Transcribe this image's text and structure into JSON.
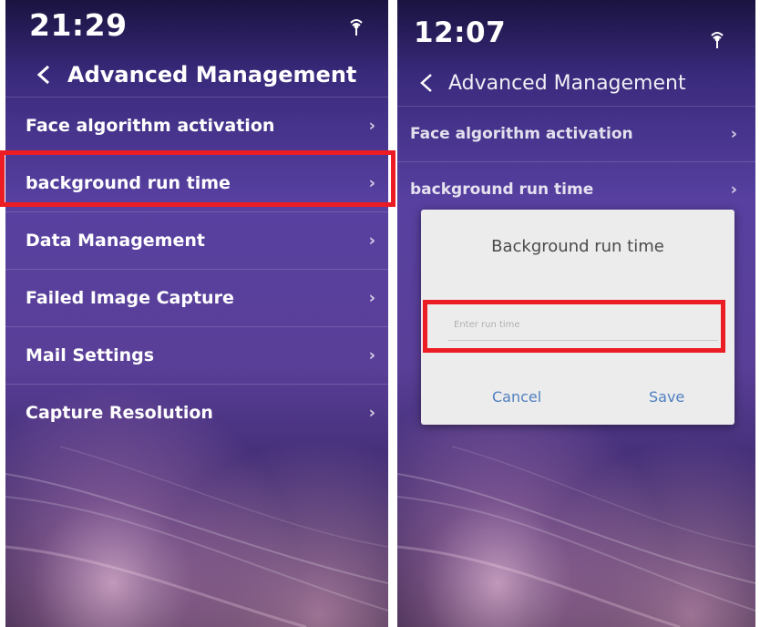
{
  "left_screen": {
    "status_time": "21:29",
    "status_icon": "wifi-icon",
    "header": {
      "back_icon": "chevron-left-icon",
      "title": "Advanced Management"
    },
    "menu": [
      {
        "label": "Face algorithm activation",
        "icon": "chevron-right-icon"
      },
      {
        "label": "background run time",
        "icon": "chevron-right-icon",
        "highlighted": true
      },
      {
        "label": "Data Management",
        "icon": "chevron-right-icon"
      },
      {
        "label": "Failed Image Capture",
        "icon": "chevron-right-icon"
      },
      {
        "label": "Mail Settings",
        "icon": "chevron-right-icon"
      },
      {
        "label": "Capture Resolution",
        "icon": "chevron-right-icon"
      }
    ]
  },
  "right_screen": {
    "status_time": "12:07",
    "status_icon": "wifi-icon",
    "header": {
      "back_icon": "chevron-left-icon",
      "title": "Advanced Management"
    },
    "menu": [
      {
        "label": "Face algorithm activation",
        "icon": "chevron-right-icon"
      },
      {
        "label": "background run time",
        "icon": "chevron-right-icon"
      }
    ],
    "dialog": {
      "title": "Background run time",
      "input_value": "",
      "input_placeholder": "Enter run time",
      "cancel_label": "Cancel",
      "save_label": "Save"
    }
  },
  "colors": {
    "highlight_border": "#ec1c24",
    "dialog_button": "#4f7fc0",
    "dialog_background": "#ececec"
  }
}
